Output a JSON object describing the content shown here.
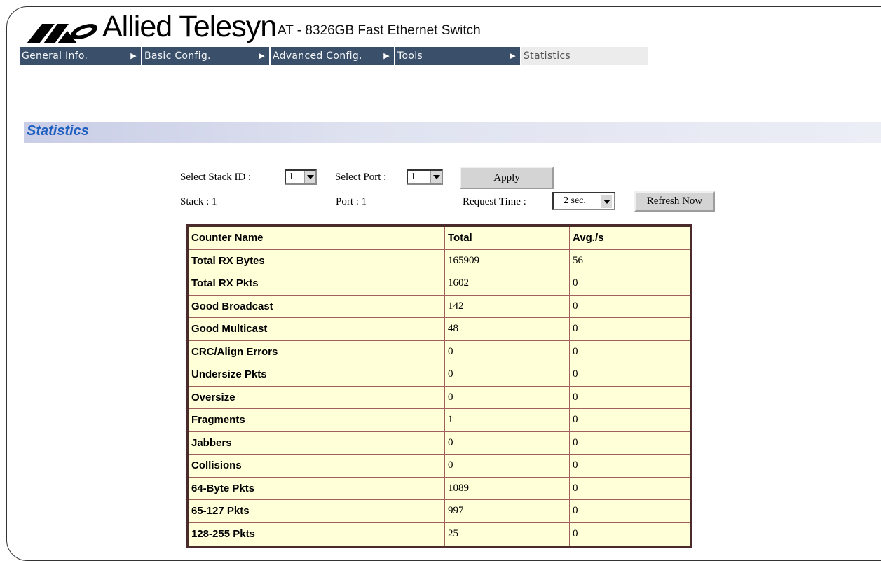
{
  "header": {
    "brand": "Allied Telesyn",
    "product": "AT - 8326GB Fast Ethernet Switch"
  },
  "nav": [
    {
      "label": "General Info."
    },
    {
      "label": "Basic Config."
    },
    {
      "label": "Advanced Config."
    },
    {
      "label": "Tools"
    },
    {
      "label": "Statistics"
    }
  ],
  "page_title": "Statistics",
  "controls": {
    "stack_label": "Select Stack ID :",
    "stack_value": "1",
    "port_label": "Select Port :",
    "port_value": "1",
    "apply_label": "Apply",
    "stack_info": "Stack : 1",
    "port_info": "Port : 1",
    "request_label": "Request Time :",
    "request_value": "2 sec.",
    "refresh_label": "Refresh Now"
  },
  "table": {
    "headers": [
      "Counter Name",
      "Total",
      "Avg./s"
    ],
    "rows": [
      {
        "name": "Total RX Bytes",
        "total": "165909",
        "avg": "56"
      },
      {
        "name": "Total RX Pkts",
        "total": "1602",
        "avg": "0"
      },
      {
        "name": "Good Broadcast",
        "total": "142",
        "avg": "0"
      },
      {
        "name": "Good Multicast",
        "total": "48",
        "avg": "0"
      },
      {
        "name": "CRC/Align Errors",
        "total": "0",
        "avg": "0"
      },
      {
        "name": "Undersize Pkts",
        "total": "0",
        "avg": "0"
      },
      {
        "name": "Oversize",
        "total": "0",
        "avg": "0"
      },
      {
        "name": "Fragments",
        "total": "1",
        "avg": "0"
      },
      {
        "name": "Jabbers",
        "total": "0",
        "avg": "0"
      },
      {
        "name": "Collisions",
        "total": "0",
        "avg": "0"
      },
      {
        "name": "64-Byte Pkts",
        "total": "1089",
        "avg": "0"
      },
      {
        "name": "65-127 Pkts",
        "total": "997",
        "avg": "0"
      },
      {
        "name": "128-255 Pkts",
        "total": "25",
        "avg": "0"
      }
    ]
  }
}
